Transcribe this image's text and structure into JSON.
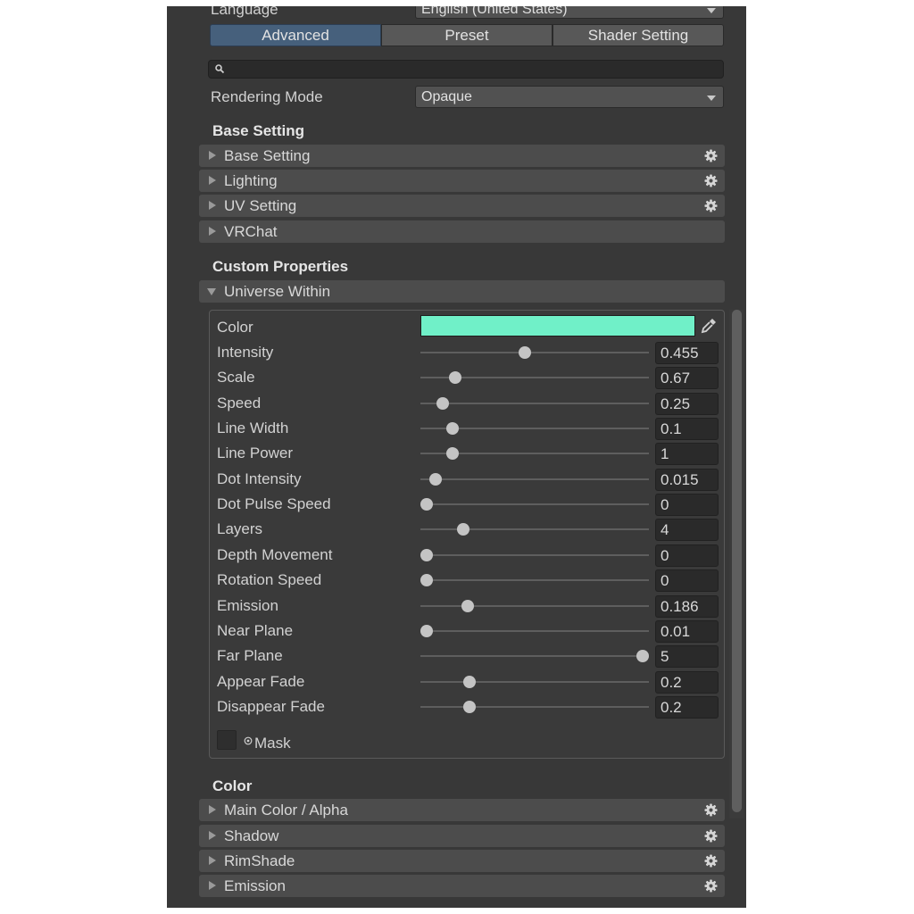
{
  "language": {
    "label": "Language",
    "value": "English (United States)"
  },
  "tabs": [
    "Advanced",
    "Preset",
    "Shader Setting"
  ],
  "active_tab": "Advanced",
  "search": {
    "placeholder": "",
    "icon": "search-icon"
  },
  "rendering_mode": {
    "label": "Rendering Mode",
    "value": "Opaque"
  },
  "base_section": {
    "title": "Base Setting",
    "foldouts": [
      {
        "label": "Base Setting",
        "gear": true
      },
      {
        "label": "Lighting",
        "gear": true
      },
      {
        "label": "UV Setting",
        "gear": true
      },
      {
        "label": "VRChat",
        "gear": false
      }
    ]
  },
  "custom_section": {
    "title": "Custom Properties",
    "foldout": "Universe Within",
    "color": {
      "label": "Color",
      "value": "#70f0c8"
    },
    "sliders": [
      {
        "label": "Intensity",
        "value": "0.455",
        "fraction": 0.455
      },
      {
        "label": "Scale",
        "value": "0.67",
        "fraction": 0.134
      },
      {
        "label": "Speed",
        "value": "0.25",
        "fraction": 0.075
      },
      {
        "label": "Line Width",
        "value": "0.1",
        "fraction": 0.12
      },
      {
        "label": "Line Power",
        "value": "1",
        "fraction": 0.12
      },
      {
        "label": "Dot Intensity",
        "value": "0.015",
        "fraction": 0.04
      },
      {
        "label": "Dot Pulse Speed",
        "value": "0",
        "fraction": 0.0
      },
      {
        "label": "Layers",
        "value": "4",
        "fraction": 0.17
      },
      {
        "label": "Depth Movement",
        "value": "0",
        "fraction": 0.0
      },
      {
        "label": "Rotation Speed",
        "value": "0",
        "fraction": 0.0
      },
      {
        "label": "Emission",
        "value": "0.186",
        "fraction": 0.19
      },
      {
        "label": "Near Plane",
        "value": "0.01",
        "fraction": 0.0
      },
      {
        "label": "Far Plane",
        "value": "5",
        "fraction": 1.0
      },
      {
        "label": "Appear Fade",
        "value": "0.2",
        "fraction": 0.2
      },
      {
        "label": "Disappear Fade",
        "value": "0.2",
        "fraction": 0.2
      }
    ],
    "mask": {
      "label": "Mask"
    }
  },
  "color_section": {
    "title": "Color",
    "foldouts": [
      {
        "label": "Main Color / Alpha",
        "gear": true
      },
      {
        "label": "Shadow",
        "gear": true
      },
      {
        "label": "RimShade",
        "gear": true
      },
      {
        "label": "Emission",
        "gear": true
      }
    ]
  },
  "colors": {
    "panel": "#383838",
    "accent_tab": "#46607c",
    "swatch": "#70f0c8"
  }
}
